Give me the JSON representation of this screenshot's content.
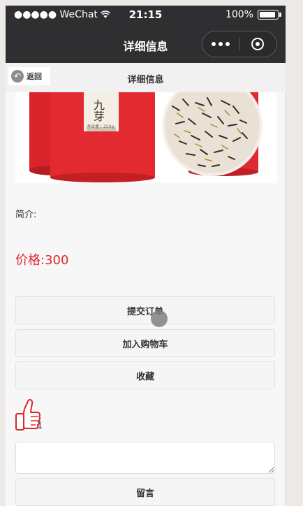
{
  "status_bar": {
    "carrier": "●●●●● WeChat",
    "time": "21:15",
    "battery": "100%"
  },
  "nav_bar": {
    "title": "详细信息"
  },
  "header": {
    "back_label": "返回",
    "title": "详细信息"
  },
  "product": {
    "image_text": "九芽",
    "image_small_text": "净含量：250g",
    "intro_label": "简介:",
    "price_label": "价格:300"
  },
  "buttons": {
    "submit_order": "提交订单",
    "add_to_cart": "加入购物车",
    "favorite": "收藏",
    "leave_message": "留言"
  },
  "like": {
    "count": "1"
  },
  "message_input": {
    "value": "",
    "placeholder": ""
  },
  "colors": {
    "nav_bg": "#2f2f31",
    "price": "#e0262c",
    "thumb_outline": "#d9282f"
  },
  "icons": {
    "back": "back-arrow-circle-icon",
    "like": "thumbs-up-icon",
    "more": "more-dots-icon",
    "close": "target-close-icon"
  }
}
